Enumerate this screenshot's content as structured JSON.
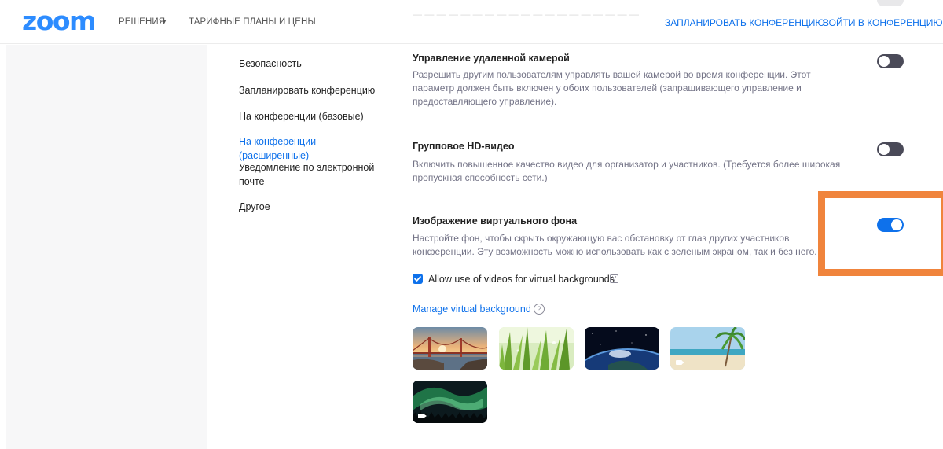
{
  "header": {
    "logo": "zoom",
    "nav": {
      "solutions": "РЕШЕНИЯ",
      "solutions_caret": "▾",
      "plans": "ТАРИФНЫЕ ПЛАНЫ И ЦЕНЫ",
      "schedule": "ЗАПЛАНИРОВАТЬ КОНФЕРЕНЦИЮ",
      "join": "ВОЙТИ В КОНФЕРЕНЦИЮ"
    }
  },
  "side_menu": {
    "items": [
      {
        "label": "Безопасность",
        "active": false
      },
      {
        "label": "Запланировать конференцию",
        "active": false
      },
      {
        "label": "На конференции (базовые)",
        "active": false
      },
      {
        "label": "На конференции (расширенные)",
        "active": true
      },
      {
        "label": "Уведомление по электронной почте",
        "active": false
      },
      {
        "label": "Другое",
        "active": false
      }
    ]
  },
  "settings": [
    {
      "title": "Управление удаленной камерой",
      "description": "Разрешить другим пользователям управлять вашей камерой во время конференции. Этот параметр должен быть включен у обоих пользователей (запрашивающего управление и предоставляющего управление).",
      "enabled": false
    },
    {
      "title": "Групповое HD-видео",
      "description": "Включить повышенное качество видео для организатор и участников. (Требуется более широкая пропускная способность сети.)",
      "enabled": false
    },
    {
      "title": "Изображение виртуального фона",
      "description": "Настройте фон, чтобы скрыть окружающую вас обстановку от глаз других участников конференции. Эту возможность можно использовать как с зеленым экраном, так и без него.",
      "enabled": true
    }
  ],
  "virtual_background": {
    "allow_videos_label": "Allow use of videos for virtual backgrounds",
    "allow_videos_checked": true,
    "video_badge": "V",
    "manage_link": "Manage virtual background",
    "help_glyph": "?",
    "thumbnails": [
      {
        "name": "golden-gate-bridge",
        "is_video": false
      },
      {
        "name": "grass",
        "is_video": false
      },
      {
        "name": "earth-from-space",
        "is_video": false
      },
      {
        "name": "beach-palm",
        "is_video": true
      },
      {
        "name": "aurora",
        "is_video": true
      }
    ]
  },
  "colors": {
    "accent": "#0E71EB",
    "logo": "#2D8CFF",
    "highlight": "#F0843C",
    "toggle_off": "#4a4a58"
  }
}
